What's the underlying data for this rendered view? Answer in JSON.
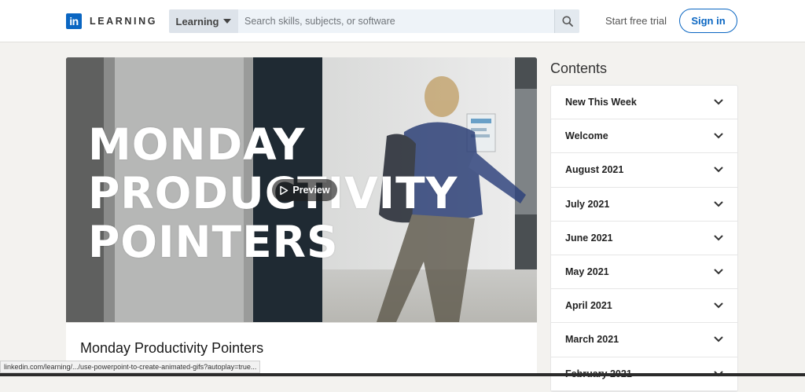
{
  "header": {
    "brand_badge": "in",
    "brand_word": "LEARNING",
    "search_scope": "Learning",
    "search_placeholder": "Search skills, subjects, or software",
    "free_trial_label": "Start free trial",
    "sign_in_label": "Sign in"
  },
  "video": {
    "overlay_lines": [
      "MONDAY",
      "PRODUCTIVITY",
      "POINTERS"
    ],
    "preview_label": "Preview"
  },
  "course": {
    "title": "Monday Productivity Pointers"
  },
  "contents": {
    "heading": "Contents",
    "items": [
      "New This Week",
      "Welcome",
      "August 2021",
      "July 2021",
      "June 2021",
      "May 2021",
      "April 2021",
      "March 2021",
      "February 2021"
    ]
  },
  "status_bar": {
    "url": "linkedin.com/learning/.../use-powerpoint-to-create-animated-gifs?autoplay=true..."
  },
  "colors": {
    "brand_blue": "#0a66c2",
    "page_bg": "#f3f2ef"
  }
}
